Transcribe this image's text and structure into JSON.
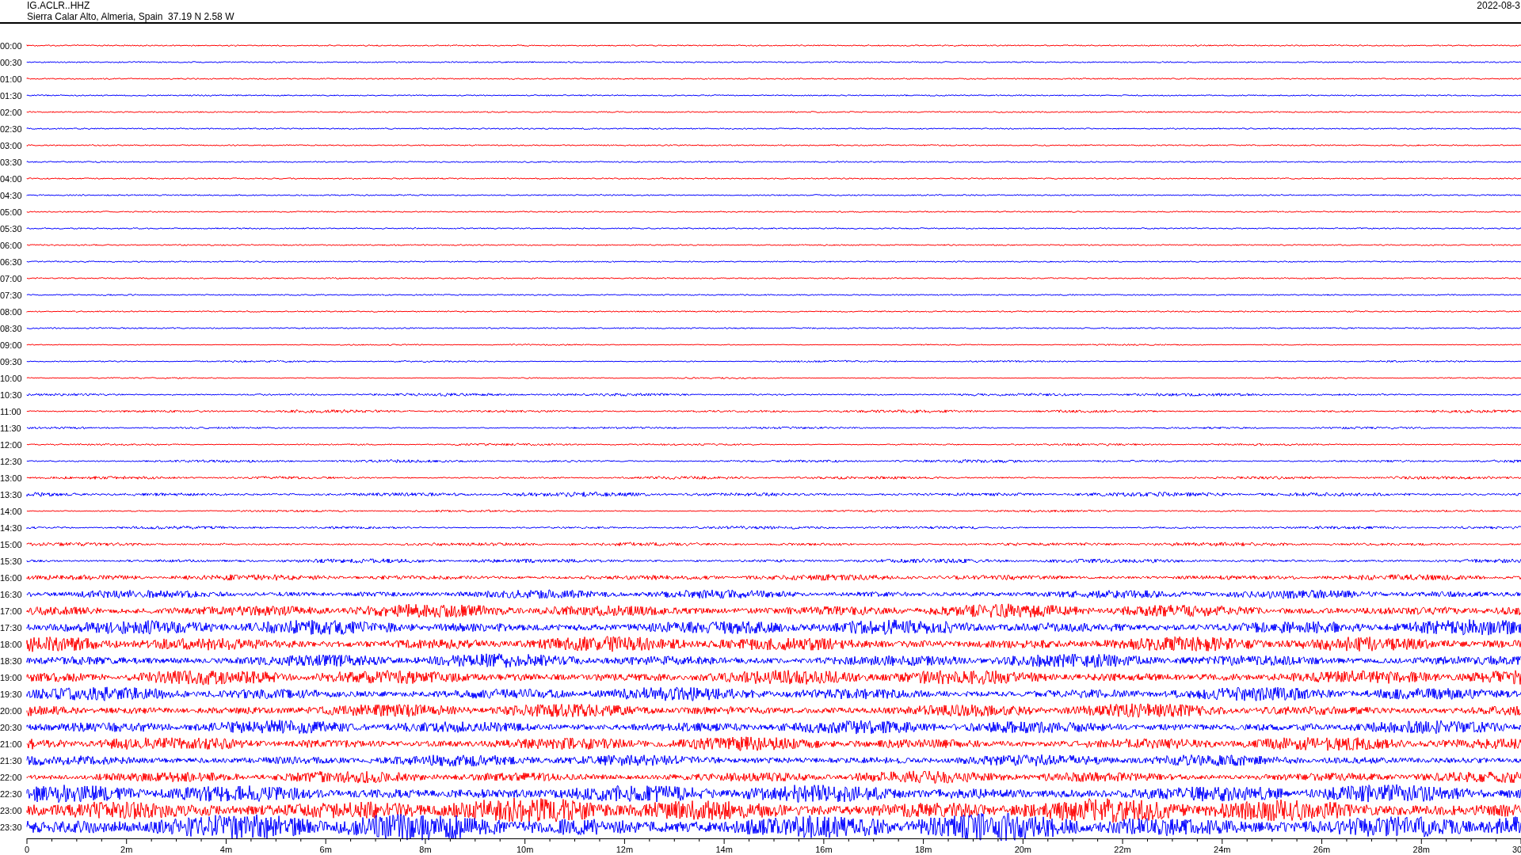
{
  "header": {
    "station": "IG.ACLR..HHZ",
    "location": "Sierra Calar Alto, Almeria, Spain  37.19 N 2.58 W",
    "date": "2022-08-3"
  },
  "traces": [
    {
      "label": "00:00",
      "color": "#ff0000"
    },
    {
      "label": "00:30",
      "color": "#0000ff"
    },
    {
      "label": "01:00",
      "color": "#ff0000"
    },
    {
      "label": "01:30",
      "color": "#0000ff"
    },
    {
      "label": "02:00",
      "color": "#ff0000"
    },
    {
      "label": "02:30",
      "color": "#0000ff"
    },
    {
      "label": "03:00",
      "color": "#ff0000"
    },
    {
      "label": "03:30",
      "color": "#0000ff"
    },
    {
      "label": "04:00",
      "color": "#ff0000"
    },
    {
      "label": "04:30",
      "color": "#0000ff"
    },
    {
      "label": "05:00",
      "color": "#ff0000"
    },
    {
      "label": "05:30",
      "color": "#0000ff"
    },
    {
      "label": "06:00",
      "color": "#ff0000"
    },
    {
      "label": "06:30",
      "color": "#0000ff"
    },
    {
      "label": "07:00",
      "color": "#ff0000"
    },
    {
      "label": "07:30",
      "color": "#0000ff"
    },
    {
      "label": "08:00",
      "color": "#ff0000"
    },
    {
      "label": "08:30",
      "color": "#0000ff"
    },
    {
      "label": "09:00",
      "color": "#ff0000"
    },
    {
      "label": "09:30",
      "color": "#0000ff"
    },
    {
      "label": "10:00",
      "color": "#ff0000"
    },
    {
      "label": "10:30",
      "color": "#0000ff"
    },
    {
      "label": "11:00",
      "color": "#ff0000"
    },
    {
      "label": "11:30",
      "color": "#0000ff"
    },
    {
      "label": "12:00",
      "color": "#ff0000"
    },
    {
      "label": "12:30",
      "color": "#0000ff"
    },
    {
      "label": "13:00",
      "color": "#ff0000"
    },
    {
      "label": "13:30",
      "color": "#0000ff"
    },
    {
      "label": "14:00",
      "color": "#ff0000"
    },
    {
      "label": "14:30",
      "color": "#0000ff"
    },
    {
      "label": "15:00",
      "color": "#ff0000"
    },
    {
      "label": "15:30",
      "color": "#0000ff"
    },
    {
      "label": "16:00",
      "color": "#ff0000"
    },
    {
      "label": "16:30",
      "color": "#0000ff"
    },
    {
      "label": "17:00",
      "color": "#ff0000"
    },
    {
      "label": "17:30",
      "color": "#0000ff"
    },
    {
      "label": "18:00",
      "color": "#ff0000"
    },
    {
      "label": "18:30",
      "color": "#0000ff"
    },
    {
      "label": "19:00",
      "color": "#ff0000"
    },
    {
      "label": "19:30",
      "color": "#0000ff"
    },
    {
      "label": "20:00",
      "color": "#ff0000"
    },
    {
      "label": "20:30",
      "color": "#0000ff"
    },
    {
      "label": "21:00",
      "color": "#ff0000"
    },
    {
      "label": "21:30",
      "color": "#0000ff"
    },
    {
      "label": "22:00",
      "color": "#ff0000"
    },
    {
      "label": "22:30",
      "color": "#0000ff"
    },
    {
      "label": "23:00",
      "color": "#ff0000"
    },
    {
      "label": "23:30",
      "color": "#0000ff"
    }
  ],
  "x_axis": {
    "ticks": [
      "0",
      "2m",
      "4m",
      "6m",
      "8m",
      "10m",
      "12m",
      "14m",
      "16m",
      "18m",
      "20m",
      "22m",
      "24m",
      "26m",
      "28m",
      "30"
    ]
  }
}
